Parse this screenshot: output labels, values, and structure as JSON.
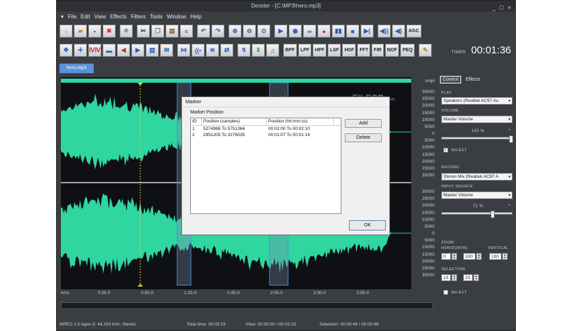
{
  "window": {
    "title": "Dexster - [C:\\MP3\\hero.mp3]",
    "controls": [
      "_",
      "□",
      "×"
    ]
  },
  "menu": [
    "File",
    "Edit",
    "View",
    "Effects",
    "Filters",
    "Tools",
    "Window",
    "Help"
  ],
  "toolbar": {
    "text_buttons_row1": [
      "AGC"
    ],
    "text_buttons_row2": [
      "BPF",
      "LPF",
      "HPF",
      "LSF",
      "HSF",
      "FFT",
      "FIR",
      "NOF",
      "PEQ"
    ]
  },
  "timer": {
    "label": "TIMER",
    "value": "00:01:36"
  },
  "tab": {
    "label": "hero.mp3"
  },
  "scale": {
    "unit": "smpl",
    "upper": [
      "30000",
      "25000",
      "20000",
      "15000",
      "10000",
      "5000",
      "0",
      "5000",
      "10000",
      "15000",
      "20000",
      "25000",
      "30000"
    ],
    "lower": [
      "30000",
      "25000",
      "20000",
      "15000",
      "10000",
      "5000",
      "0",
      "5000",
      "10000",
      "15000",
      "20000",
      "25000",
      "30000"
    ]
  },
  "ruler": {
    "unit": "hms",
    "ticks": [
      "0:25.0",
      "0:50.0",
      "1:15.0",
      "1:40.0",
      "2:05.0",
      "2:30.0",
      "2:55.0"
    ]
  },
  "status": {
    "format": "MPEG 1.0 layer-3: 44,100 kHz; Stereo;",
    "total": "Total time: 00:03:19",
    "view": "View: 00:00:00 / 00:03:19",
    "selection": "Selection: 00:00:46 / 00:00:46"
  },
  "panel": {
    "tabs": [
      "Control",
      "Effects"
    ],
    "play_label": "PLAY",
    "play_device": "Speakers (Realtek AC97 Au",
    "volume_label": "VOLUME",
    "volume_source": "Master Volume",
    "volume_percent": "100 %",
    "volume_level": 1.0,
    "select1_label": "SELECT",
    "select1_mark": "✓",
    "record_label": "RECORD",
    "record_device": "Stereo Mix (Realtek AC97 A",
    "input_label": "INPUT SOURCE",
    "input_source": "Master Volume",
    "input_percent": "72 %",
    "input_level": 0.72,
    "zoom_label": "ZOOM",
    "horizontal_label": "HORIZONTAL",
    "vertical_label": "VERTICAL",
    "zoom_h_start": "0",
    "zoom_h_end": "100",
    "zoom_v": "100",
    "selection_label": "SELECTION",
    "sel_start": "23",
    "sel_end": "23",
    "select2_label": "SELECT",
    "minus": "-",
    "plus": "+"
  },
  "dialog": {
    "title": "Marker",
    "group": "Marker Position",
    "columns": [
      "ID",
      "Position (samples)",
      "Position (hh:mm:ss)"
    ],
    "rows": [
      {
        "id": "1",
        "samples": "5274988 To  5751364",
        "time": "00:02:00 To 00:02:10"
      },
      {
        "id": "2",
        "samples": "2951205 To  3276535",
        "time": "00:01:07 To 00:01:14"
      }
    ],
    "add": "Add",
    "delete": "Delete",
    "ok": "OK"
  },
  "watermark": {
    "text": "FILECR",
    "suffix": ".com"
  },
  "colors": {
    "wave": "#2fd6a0",
    "cursor": "#e6d23a",
    "marker": "#4a8fd8",
    "accent": "#5a92d8"
  }
}
